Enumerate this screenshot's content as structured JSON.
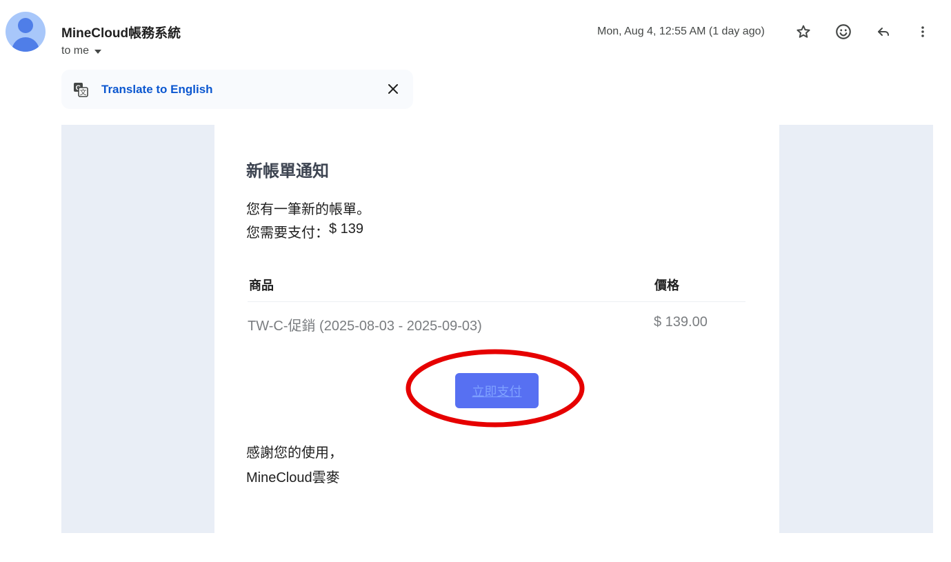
{
  "header": {
    "sender_name": "MineCloud帳務系統",
    "recipient": "to me",
    "timestamp": "Mon, Aug 4, 12:55 AM (1 day ago)",
    "icons": [
      "person-avatar-icon",
      "star-icon",
      "emoji-reaction-icon",
      "reply-icon",
      "more-vert-icon"
    ]
  },
  "translate_bar": {
    "link_text": "Translate to English",
    "icons": [
      "translate-icon",
      "close-icon"
    ]
  },
  "email": {
    "title": "新帳單通知",
    "line1": "您有一筆新的帳單。",
    "amount_label": "您需要支付：",
    "amount_value": "$ 139",
    "table": {
      "headers": [
        "商品",
        "價格"
      ],
      "rows": [
        {
          "item": "TW-C-促銷 (2025-08-03 - 2025-09-03)",
          "price": "$ 139.00"
        }
      ]
    },
    "pay_button_label": "立即支付",
    "thanks": "感謝您的使用，",
    "signoff": "MineCloud雲麥"
  },
  "colors": {
    "email_background": "#e9eef6",
    "pay_button": "#5770f2",
    "highlight_ellipse": "#e60000",
    "link_blue": "#0b57d0"
  }
}
